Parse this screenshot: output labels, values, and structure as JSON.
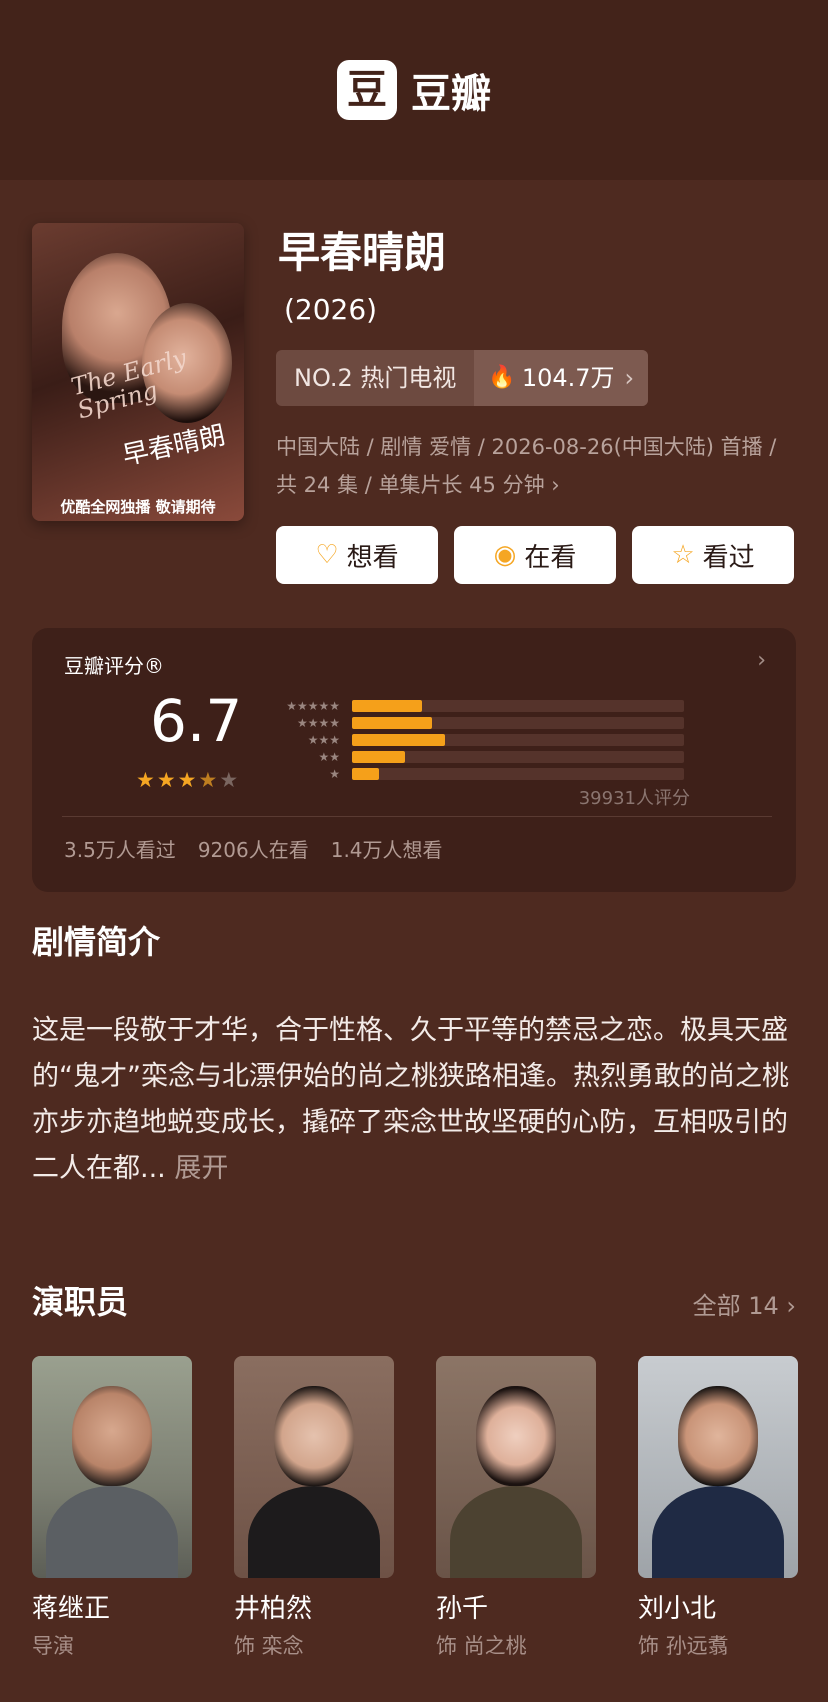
{
  "header": {
    "logo_glyph": "豆",
    "logo_text": "豆瓣"
  },
  "poster": {
    "title_en": "The Early Spring",
    "title_cn": "早春晴朗",
    "banner": "优酷全网独播 敬请期待"
  },
  "show": {
    "title": "早春晴朗",
    "year": "(2026)",
    "rank_label": "NO.2 热门电视",
    "heat": "104.7万",
    "meta": "中国大陆 / 剧情 爱情 / 2026-08-26(中国大陆) 首播 / 共 24 集 / 单集片长 45 分钟"
  },
  "actions": {
    "want": "想看",
    "watching": "在看",
    "watched": "看过",
    "want_icon": "heart-plus-icon",
    "watching_icon": "target-icon",
    "watched_icon": "star-outline-icon"
  },
  "rating": {
    "label": "豆瓣评分®",
    "score": "6.7",
    "stars": 3.5,
    "distribution": [
      {
        "stars": "★★★★★",
        "fraction": 0.21
      },
      {
        "stars": "★★★★",
        "fraction": 0.24
      },
      {
        "stars": "★★★",
        "fraction": 0.28
      },
      {
        "stars": "★★",
        "fraction": 0.16
      },
      {
        "stars": "★",
        "fraction": 0.08
      }
    ],
    "count": "39931人评分",
    "stat_watched": "3.5万人看过",
    "stat_watching": "9206人在看",
    "stat_want": "1.4万人想看"
  },
  "synopsis": {
    "title": "剧情简介",
    "text": "这是一段敬于才华，合于性格、久于平等的禁忌之恋。极具天盛的“鬼才”栾念与北漂伊始的尚之桃狭路相逢。热烈勇敢的尚之桃亦步亦趋地蜕变成长，撬碎了栾念世故坚硬的心防，互相吸引的二人在都...",
    "expand": "展开"
  },
  "cast": {
    "title": "演职员",
    "all_label": "全部 14",
    "members": [
      {
        "name": "蒋继正",
        "role": "导演"
      },
      {
        "name": "井柏然",
        "role": "饰 栾念"
      },
      {
        "name": "孙千",
        "role": "饰 尚之桃"
      },
      {
        "name": "刘小北",
        "role": "饰 孙远翥"
      }
    ]
  },
  "colors": {
    "background": "#4e2a20",
    "header": "#43231a",
    "card": "#3e2019",
    "accent": "#f5a623"
  }
}
